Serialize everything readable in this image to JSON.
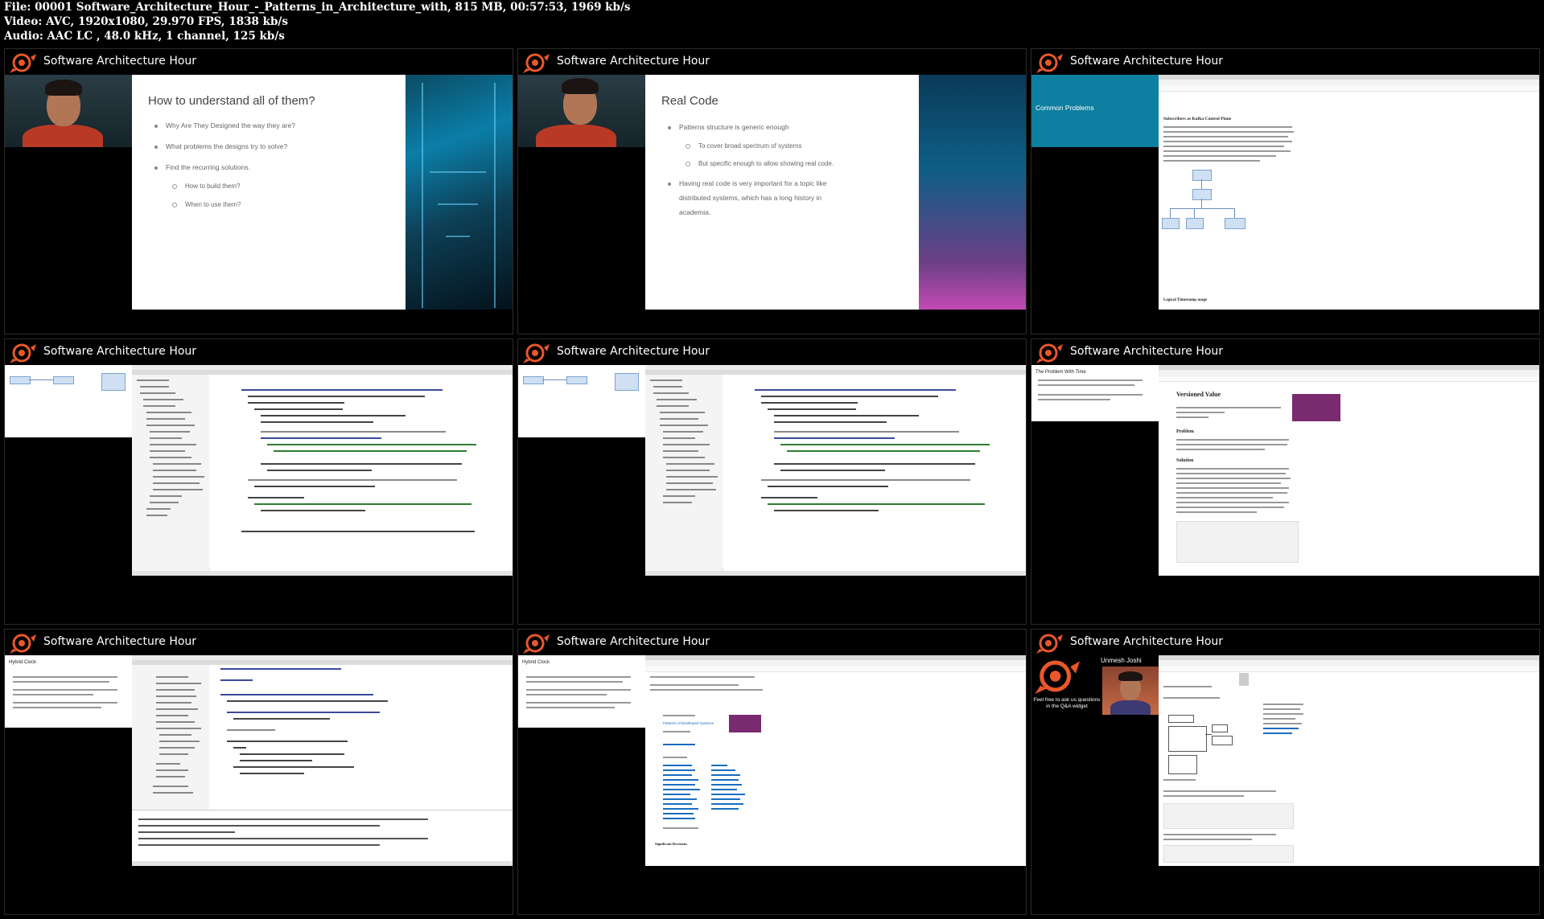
{
  "file_info": {
    "line1": "File: 00001 Software_Architecture_Hour_-_Patterns_in_Architecture_with, 815 MB, 00:57:53, 1969 kb/s",
    "line2": "Video: AVC, 1920x1080, 29.970 FPS, 1838 kb/s",
    "line3": "Audio: AAC LC , 48.0 kHz, 1 channel, 125 kb/s"
  },
  "brand": "Software Architecture Hour",
  "frames": [
    {
      "slide_title": "How to understand all of them?",
      "bullets": [
        "Why Are They Designed the way they are?",
        "What problems the designs try to solve?",
        "Find the recurring solutions."
      ],
      "sub_bullets": [
        "How to build them?",
        "When to use them?"
      ]
    },
    {
      "slide_title": "Real Code",
      "bullets": [
        "Patterns structure is generic enough",
        "Having real code is very important for a topic like",
        "distributed systems, which has a long history in",
        "academia."
      ],
      "sub_bullets": [
        "To cover broad spectrum of systems",
        "But specific enough to allow showing real code."
      ]
    },
    {
      "side_label": "Common Problems",
      "page_title": "Subscribers as Kafka Control Plane",
      "footer": "Logical Timestamp usage"
    },
    {
      "kind": "ide"
    },
    {
      "kind": "ide"
    },
    {
      "side_label": "The Problem With Time",
      "page_title": "Versioned Value",
      "sections": [
        "Problem",
        "Solution"
      ]
    },
    {
      "side_label": "Hybrid Clock"
    },
    {
      "side_label": "Hybrid Clock",
      "link": "Patterns of Distributed Systems",
      "sub": "Significant Revisions"
    },
    {
      "presenter": "Unmesh Joshi",
      "qa_text": "Feel free to ask us questions in the Q&A widget"
    }
  ]
}
